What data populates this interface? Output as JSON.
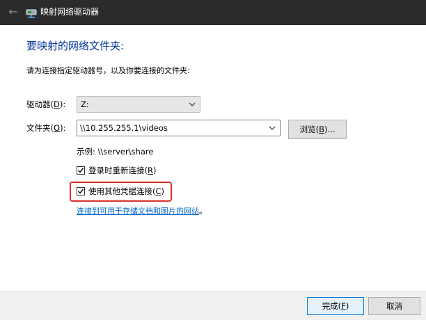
{
  "window": {
    "title": "映射网络驱动器",
    "back_icon": "←"
  },
  "heading": "要映射的网络文件夹:",
  "instruction": "请为连接指定驱动器号，以及你要连接的文件夹:",
  "drive": {
    "label_prefix": "驱动器(",
    "label_key": "D",
    "label_suffix": "):",
    "value": "Z:"
  },
  "folder": {
    "label_prefix": "文件夹(",
    "label_key": "O",
    "label_suffix": "):",
    "value": "\\\\10.255.255.1\\videos"
  },
  "browse": {
    "prefix": "浏览(",
    "key": "B",
    "suffix": ")..."
  },
  "example": "示例: \\\\server\\share",
  "reconnect": {
    "checked": true,
    "label_prefix": "登录时重新连接(",
    "label_key": "R",
    "label_suffix": ")"
  },
  "credentials": {
    "checked": true,
    "label_prefix": "使用其他凭据连接(",
    "label_key": "C",
    "label_suffix": ")"
  },
  "link": {
    "text": "连接到可用于存储文档和图片的网站",
    "trailing": "。"
  },
  "footer": {
    "finish": {
      "prefix": "完成(",
      "key": "F",
      "suffix": ")"
    },
    "cancel": "取消"
  },
  "colors": {
    "titlebar": "#2b2b2b",
    "heading": "#003399",
    "link": "#0066cc",
    "highlight": "#d9322b",
    "footer": "#f0f0f0"
  }
}
